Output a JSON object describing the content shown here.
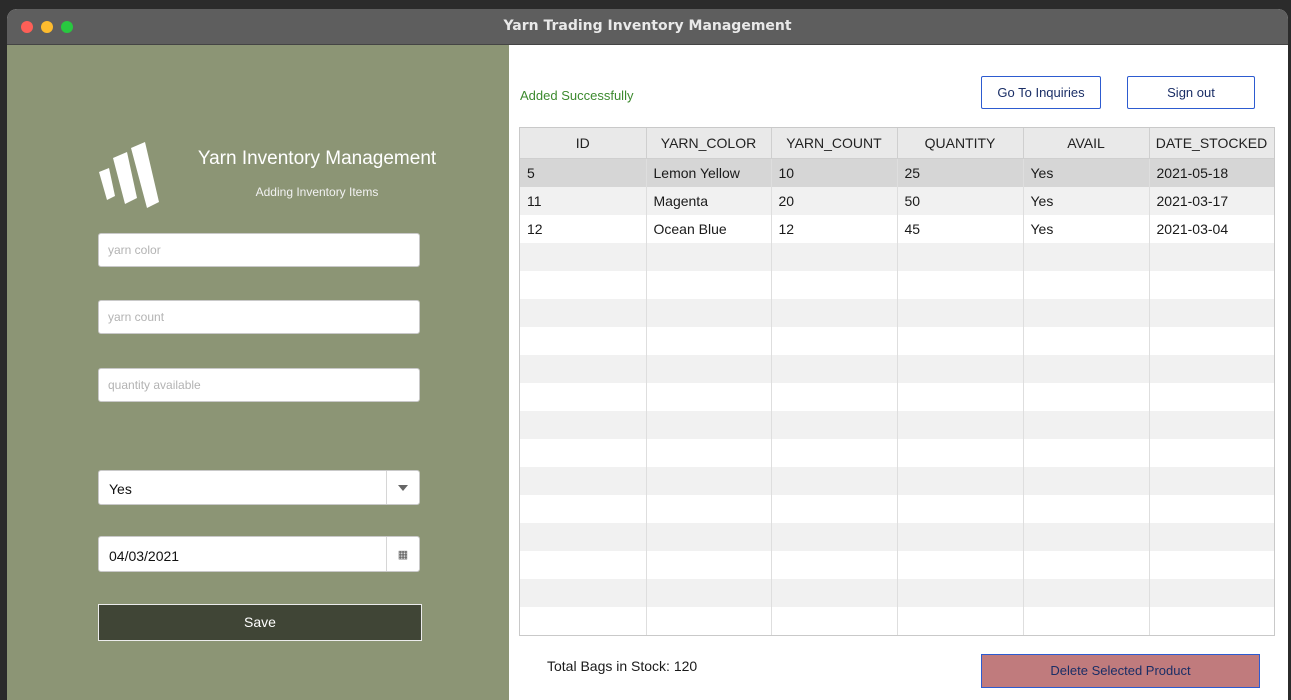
{
  "window": {
    "title": "Yarn Trading Inventory Management"
  },
  "sidebar": {
    "app_title": "Yarn Inventory Management",
    "subtitle": "Adding Inventory Items",
    "logo_icon": "yarn-logo-icon",
    "yarn_color_placeholder": "yarn color",
    "yarn_count_placeholder": "yarn count",
    "quantity_placeholder": "quantity available",
    "availability_selected": "Yes",
    "date_value": "04/03/2021",
    "save_label": "Save"
  },
  "main": {
    "status": "Added Successfully",
    "status_color": "#3c8a2e",
    "inquiries_label": "Go To Inquiries",
    "signout_label": "Sign out",
    "columns": [
      "ID",
      "YARN_COLOR",
      "YARN_COUNT",
      "QUANTITY",
      "AVAIL",
      "DATE_STOCKED"
    ],
    "rows": [
      [
        "5",
        "Lemon Yellow",
        "10",
        "25",
        "Yes",
        "2021-05-18"
      ],
      [
        "11",
        "Magenta",
        "20",
        "50",
        "Yes",
        "2021-03-17"
      ],
      [
        "12",
        "Ocean Blue",
        "12",
        "45",
        "Yes",
        "2021-03-04"
      ]
    ],
    "selected_row": 0,
    "total_label": "Total Bags in Stock: 120",
    "delete_label": "Delete Selected Product",
    "delete_color": "#c07b7d"
  }
}
